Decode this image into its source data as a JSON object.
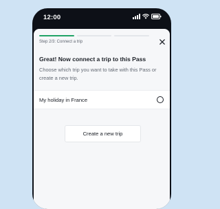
{
  "status_bar": {
    "time": "12:00",
    "icons": [
      "signal-icon",
      "wifi-icon",
      "battery-icon"
    ]
  },
  "progress": {
    "current_step": 2,
    "total_steps": 3,
    "label": "Step 2/3: Connect a trip",
    "accent_color": "#21a366"
  },
  "header": {
    "close_icon": "close-icon"
  },
  "content": {
    "title": "Great! Now connect a trip to this Pass",
    "description": "Choose which trip you want to take with this Pass or create a new trip."
  },
  "trips": [
    {
      "label": "My holiday in France",
      "selected": false
    }
  ],
  "actions": {
    "create_label": "Create a new trip"
  }
}
